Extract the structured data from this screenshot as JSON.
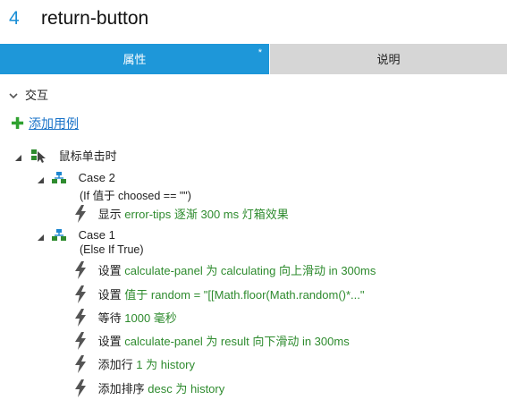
{
  "header": {
    "number": "4",
    "name": "return-button"
  },
  "tabs": [
    {
      "label": "属性",
      "badge": "*",
      "active": true
    },
    {
      "label": "说明",
      "active": false
    }
  ],
  "section": {
    "label": "交互"
  },
  "add_case": {
    "label": "添加用例"
  },
  "event": {
    "label": "鼠标单击时"
  },
  "cases": [
    {
      "name": "Case 2",
      "condition": "(If 值于 choosed == \"\")",
      "actions": [
        {
          "verb": "显示",
          "detail": "error-tips 逐渐 300 ms 灯箱效果"
        }
      ]
    },
    {
      "name": "Case 1",
      "condition": "(Else If True)",
      "actions": [
        {
          "verb": "设置",
          "detail": "calculate-panel 为 calculating 向上滑动 in 300ms"
        },
        {
          "verb": "设置",
          "detail": "值于 random = \"[[Math.floor(Math.random()*...\""
        },
        {
          "verb": "等待",
          "detail": "1000 毫秒"
        },
        {
          "verb": "设置",
          "detail": "calculate-panel 为 result 向下滑动 in 300ms"
        },
        {
          "verb": "添加行",
          "detail": "1 为 history"
        },
        {
          "verb": "添加排序",
          "detail": "desc 为 history"
        }
      ]
    }
  ],
  "colors": {
    "accent": "#1e97d9",
    "action_green": "#2e8b2e",
    "link": "#1a73c8",
    "add_plus": "#2fa12f"
  },
  "icons": {
    "event": "cursor-click-icon",
    "case": "case-tree-icon",
    "action": "lightning-bolt-icon",
    "add": "plus-icon",
    "collapse": "chevron-down-icon",
    "expand_toggle": "expand-triangle-icon"
  }
}
